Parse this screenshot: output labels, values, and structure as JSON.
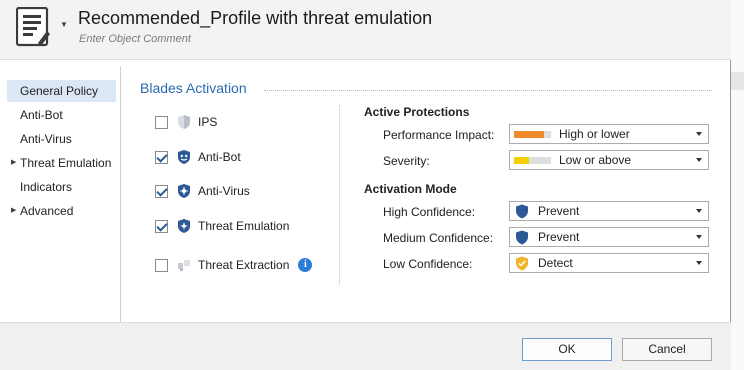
{
  "header": {
    "title": "Recommended_Profile with threat emulation",
    "comment_placeholder": "Enter Object Comment"
  },
  "nav": {
    "items": [
      {
        "label": "General Policy",
        "active": true,
        "expandable": false
      },
      {
        "label": "Anti-Bot",
        "active": false,
        "expandable": false
      },
      {
        "label": "Anti-Virus",
        "active": false,
        "expandable": false
      },
      {
        "label": "Threat Emulation",
        "active": false,
        "expandable": true
      },
      {
        "label": "Indicators",
        "active": false,
        "expandable": false
      },
      {
        "label": "Advanced",
        "active": false,
        "expandable": true
      }
    ]
  },
  "blades": {
    "title": "Blades Activation",
    "items": [
      {
        "label": "IPS",
        "checked": false,
        "icon": "ips-shield-icon"
      },
      {
        "label": "Anti-Bot",
        "checked": true,
        "icon": "anti-bot-icon"
      },
      {
        "label": "Anti-Virus",
        "checked": true,
        "icon": "anti-virus-icon"
      },
      {
        "label": "Threat Emulation",
        "checked": true,
        "icon": "threat-emulation-icon"
      },
      {
        "label": "Threat Extraction",
        "checked": false,
        "icon": "threat-extraction-icon"
      }
    ]
  },
  "active_protections": {
    "title": "Active Protections",
    "performance_label": "Performance Impact:",
    "performance_value": "High or lower",
    "performance_level": 0.8,
    "severity_label": "Severity:",
    "severity_value": "Low or above",
    "severity_level": 0.4
  },
  "activation_mode": {
    "title": "Activation Mode",
    "high_label": "High Confidence:",
    "high_value": "Prevent",
    "medium_label": "Medium Confidence:",
    "medium_value": "Prevent",
    "low_label": "Low Confidence:",
    "low_value": "Detect"
  },
  "footer": {
    "ok_label": "OK",
    "cancel_label": "Cancel"
  },
  "colors": {
    "accent": "#2b6cb0",
    "prevent_shield": "#2d5a96",
    "detect_shield": "#f0b429",
    "performance_gauge": "#f08a2c",
    "severity_gauge": "#f5d000",
    "nav_active": "#dbe7f5"
  }
}
